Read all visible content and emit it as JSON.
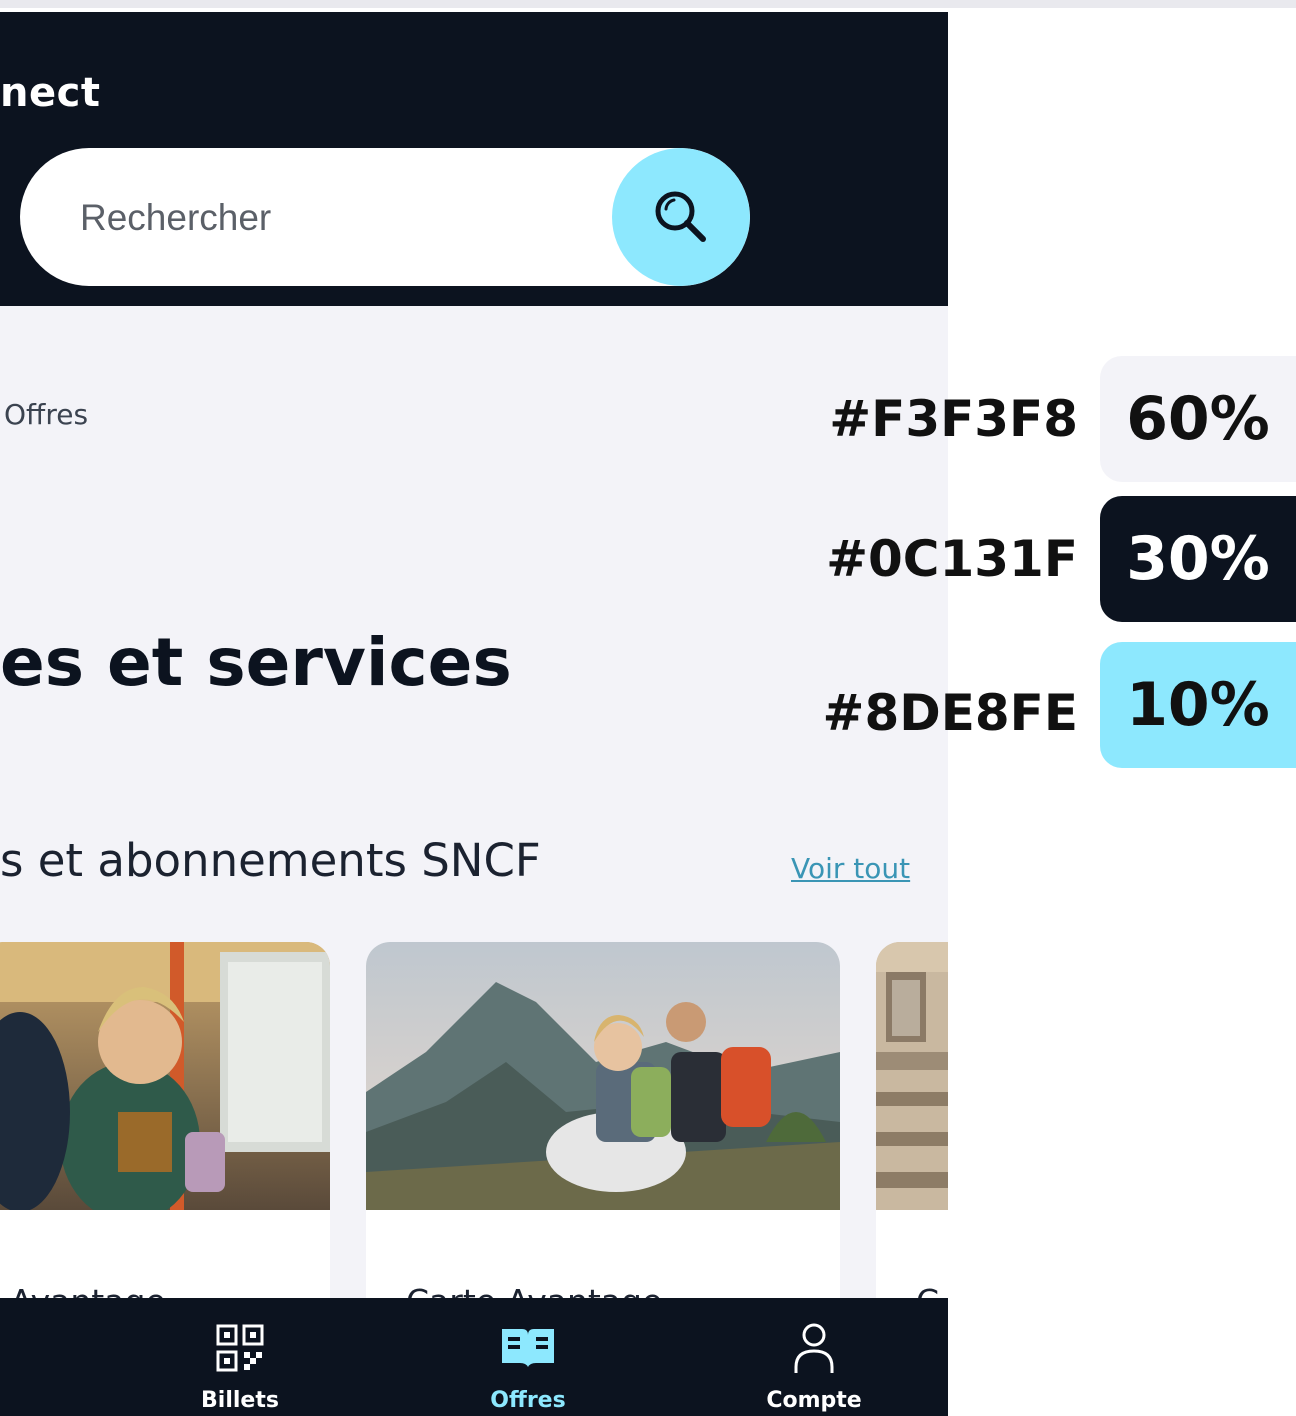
{
  "header": {
    "brand": "nect",
    "search_placeholder": "Rechercher"
  },
  "breadcrumb": "Offres",
  "page_title": "es et services",
  "section": {
    "title": "et abonnements SNCF",
    "see_all": "Voir tout"
  },
  "cards": [
    {
      "title": "Avantage"
    },
    {
      "title": "Carte Avantage"
    },
    {
      "title": "C"
    }
  ],
  "tabbar": {
    "items": [
      "Billets",
      "Offres",
      "Compte"
    ]
  },
  "palette": [
    {
      "hex": "#F3F3F8",
      "percent": "60%",
      "text_color": "#111111"
    },
    {
      "hex": "#0C131F",
      "percent": "30%",
      "text_color": "#ffffff"
    },
    {
      "hex": "#8DE8FE",
      "percent": "10%",
      "text_color": "#111111"
    }
  ]
}
